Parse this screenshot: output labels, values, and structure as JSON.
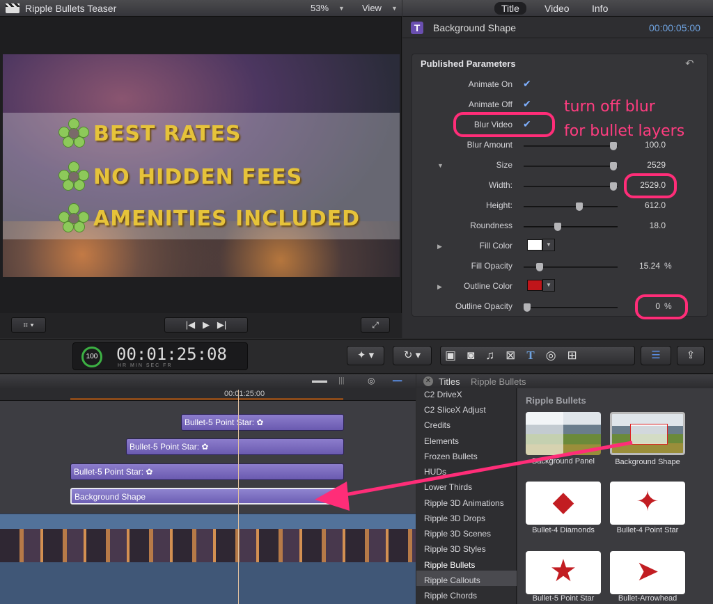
{
  "viewer": {
    "title": "Ripple Bullets Teaser",
    "zoom": "53%",
    "view_label": "View",
    "bullets": [
      "BEST RATES",
      "NO HIDDEN FEES",
      "AMENITIES INCLUDED"
    ]
  },
  "inspector": {
    "tabs": [
      "Title",
      "Video",
      "Info"
    ],
    "name": "Background Shape",
    "duration": "00:00:05:00",
    "section": "Published Parameters",
    "params": {
      "animate_on": "Animate On",
      "animate_off": "Animate Off",
      "blur_video": "Blur Video",
      "blur_amount": {
        "label": "Blur Amount",
        "value": "100.0"
      },
      "size": {
        "label": "Size",
        "value": "2529"
      },
      "width": {
        "label": "Width:",
        "value": "2529.0"
      },
      "height": {
        "label": "Height:",
        "value": "612.0"
      },
      "roundness": {
        "label": "Roundness",
        "value": "18.0"
      },
      "fill_color": {
        "label": "Fill Color",
        "color": "#ffffff"
      },
      "fill_opacity": {
        "label": "Fill Opacity",
        "value": "15.24",
        "unit": "%"
      },
      "outline_color": {
        "label": "Outline Color",
        "color": "#c0151a"
      },
      "outline_opacity": {
        "label": "Outline Opacity",
        "value": "0",
        "unit": "%"
      }
    },
    "annotation": [
      "turn off blur",
      "for bullet layers"
    ]
  },
  "toolbar": {
    "percent": "100",
    "timecode": "00:01:25:08",
    "units": "HR MIN SEC FR"
  },
  "timeline": {
    "ruler_time": "00:01:25:00",
    "clips": [
      "Bullet-5 Point Star: ✿",
      "Bullet-5 Point Star: ✿",
      "Bullet-5 Point Star: ✿",
      "Background Shape"
    ]
  },
  "browser": {
    "title": "Titles",
    "crumb": "Ripple Bullets",
    "heading": "Ripple Bullets",
    "categories": [
      "C2 DriveX",
      "C2 SliceX Adjust",
      "Credits",
      "Elements",
      "Frozen Bullets",
      "HUDs",
      "Lower Thirds",
      "Ripple 3D Animations",
      "Ripple 3D Drops",
      "Ripple 3D Scenes",
      "Ripple 3D Styles",
      "Ripple Bullets",
      "Ripple Callouts",
      "Ripple Chords"
    ],
    "items": [
      "Background Panel",
      "Background Shape",
      "Bullet-4 Diamonds",
      "Bullet-4 Point Star",
      "Bullet-5 Point Star",
      "Bullet-Arrowhead"
    ]
  },
  "colors": {
    "accent": "#ff2d78",
    "timecode_blue": "#6fa3e0"
  }
}
